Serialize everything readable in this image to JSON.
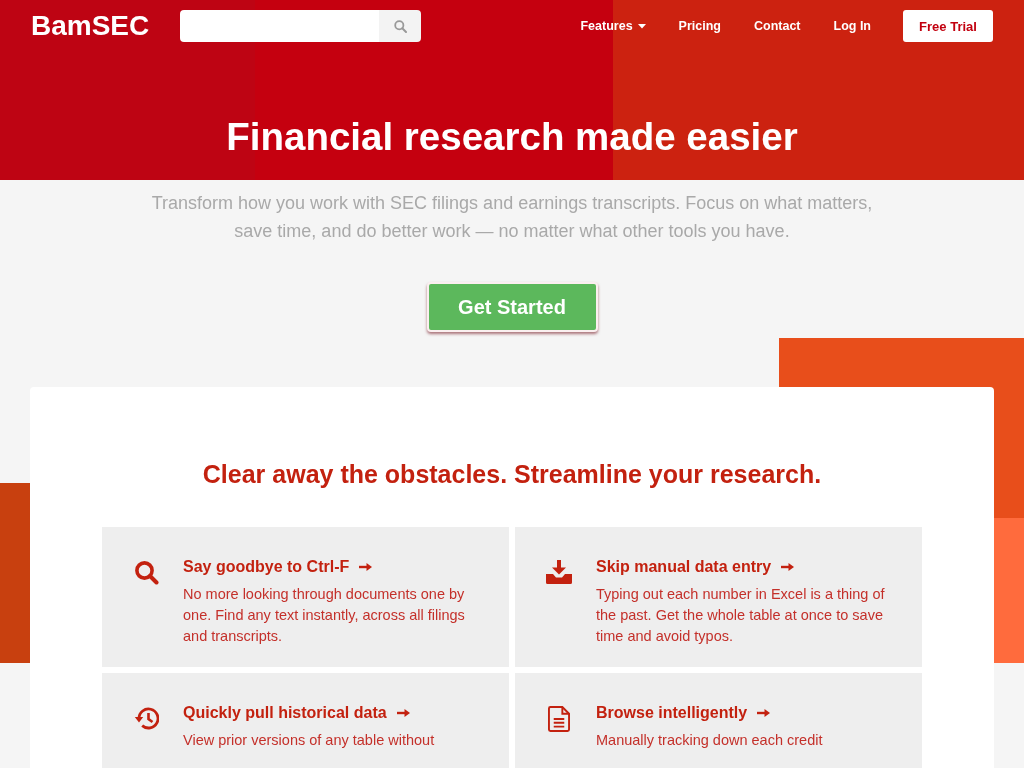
{
  "header": {
    "logo": "BamSEC",
    "nav": [
      {
        "label": "Features",
        "kind": "dropdown"
      },
      {
        "label": "Pricing",
        "kind": "link"
      },
      {
        "label": "Contact",
        "kind": "link"
      },
      {
        "label": "Log In",
        "kind": "link"
      },
      {
        "label": "Free Trial",
        "kind": "button"
      }
    ]
  },
  "hero": {
    "title": "Financial research made easier",
    "subtitle": "Transform how you work with SEC filings and earnings transcripts. Focus on what matters, save time, and do better work — no matter what other tools you have.",
    "cta": "Get Started"
  },
  "features": {
    "heading": "Clear away the obstacles. Streamline your research.",
    "items": [
      {
        "title": "Say goodbye to Ctrl-F",
        "description": "No more looking through documents one by one. Find any text instantly, across all filings and transcripts."
      },
      {
        "title": "Skip manual data entry",
        "description": "Typing out each number in Excel is a thing of the past. Get the whole table at once to save time and avoid typos."
      },
      {
        "title": "Quickly pull historical data",
        "description": "View prior versions of any table without"
      },
      {
        "title": "Browse intelligently",
        "description": "Manually tracking down each credit"
      }
    ]
  }
}
